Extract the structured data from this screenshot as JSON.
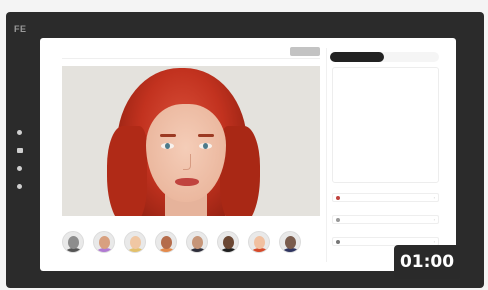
{
  "app": {
    "logo": "FE"
  },
  "editor": {
    "prompt_placeholder": "",
    "generate_label": "",
    "under_left": "",
    "under_right": ""
  },
  "panel": {
    "tab_primary": "",
    "tab_secondary": "",
    "char_count": "",
    "section1": "",
    "row1": "",
    "section2": "",
    "row2": "",
    "section3": "",
    "row3": ""
  },
  "avatars": [
    {
      "name": "",
      "skin": "#8d8d8d",
      "shirt": "#555555"
    },
    {
      "name": "",
      "skin": "#d8a07f",
      "shirt": "#b07ad2"
    },
    {
      "name": "",
      "skin": "#f0c7a3",
      "shirt": "#e2c06b"
    },
    {
      "name": "",
      "skin": "#b56c4b",
      "shirt": "#e38a4c"
    },
    {
      "name": "",
      "skin": "#c69578",
      "shirt": "#2e2e3a"
    },
    {
      "name": "",
      "skin": "#6b4733",
      "shirt": "#202020"
    },
    {
      "name": "",
      "skin": "#f1c0a0",
      "shirt": "#d64a2a"
    },
    {
      "name": "",
      "skin": "#7a5c4d",
      "shirt": "#2f3560"
    }
  ],
  "video": {
    "timestamp": "01:00"
  },
  "colors": {
    "dark_bg": "#2b2b2b",
    "accent": "#222222",
    "hair": "#c2321f"
  }
}
